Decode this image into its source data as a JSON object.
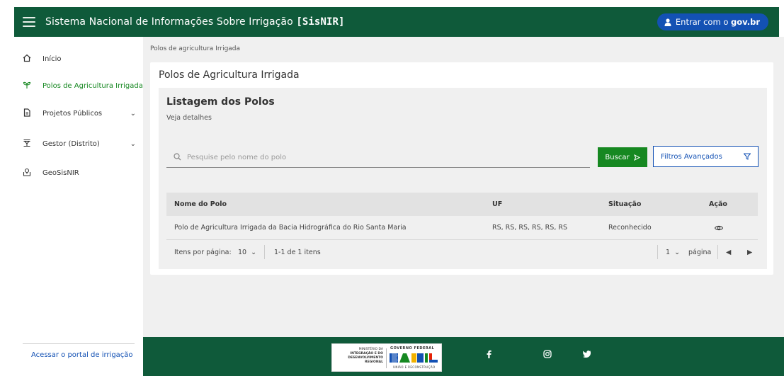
{
  "header": {
    "title_prefix": "Sistema Nacional de Informações Sobre Irrigação ",
    "title_acronym": "[SisNIR]",
    "login_prefix": "Entrar com o ",
    "login_brand": "gov.br"
  },
  "sidebar": {
    "items": [
      {
        "label": "Início",
        "icon": "home-icon"
      },
      {
        "label": "Polos de Agricultura Irrigada",
        "icon": "sprout-icon",
        "active": true
      },
      {
        "label": "Projetos Públicos",
        "icon": "document-icon",
        "expandable": true
      },
      {
        "label": "Gestor (Distrito)",
        "icon": "hierarchy-icon",
        "expandable": true
      },
      {
        "label": "GeoSisNIR",
        "icon": "map-pin-icon"
      }
    ],
    "footer_link": "Acessar o portal de irrigação"
  },
  "breadcrumb": "Polos de agricultura Irrigada",
  "card": {
    "title": "Polos de Agricultura Irrigada",
    "panel_title": "Listagem dos Polos",
    "panel_subtitle": "Veja detalhes"
  },
  "search": {
    "placeholder": "Pesquise pelo nome do polo",
    "value": "",
    "buscar_label": "Buscar",
    "filtros_label": "Filtros Avançados"
  },
  "table": {
    "headers": [
      "Nome do Polo",
      "UF",
      "Situação",
      "Ação"
    ],
    "rows": [
      {
        "nome": "Polo de Agricultura Irrigada da Bacia Hidrográfica do Rio Santa Maria",
        "uf": "RS, RS, RS, RS, RS, RS",
        "situacao": "Reconhecido"
      }
    ]
  },
  "pagination": {
    "items_label": "Itens por página:",
    "items_per_page": "10",
    "range_label": "1-1 de 1 itens",
    "page": "1",
    "page_label": "página"
  },
  "footer": {
    "ministry": [
      "MINISTÉRIO DA",
      "INTEGRAÇÃO E DO",
      "DESENVOLVIMENTO",
      "REGIONAL"
    ],
    "gov_federal": "GOVERNO FEDERAL",
    "brasil": "BRASIL",
    "union": "UNIÃO E RECONSTRUÇÃO",
    "social": [
      "facebook-icon",
      "instagram-icon",
      "twitter-icon"
    ]
  },
  "colors": {
    "header_green": "#0f5a3a",
    "accent_green": "#168821",
    "gov_blue": "#1351b4"
  }
}
